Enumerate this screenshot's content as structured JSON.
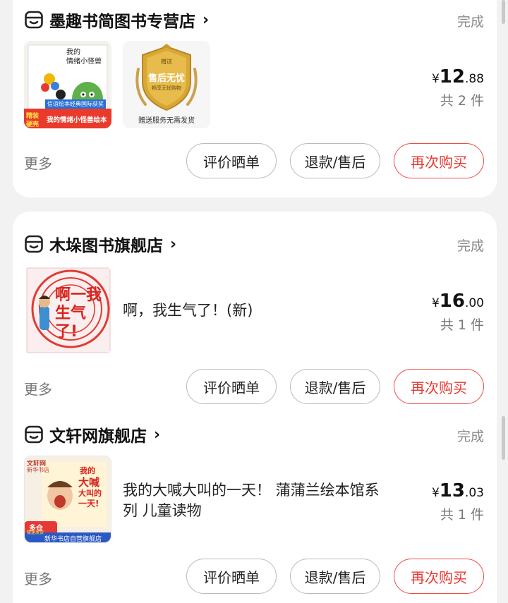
{
  "orders": [
    {
      "shop": "墨趣书简图书专营店",
      "status": "完成",
      "thumb1": {
        "line1": "我的",
        "line2": "情绪小怪兽",
        "banner": "信谊绘本经典国际获奖",
        "tag1": "精装",
        "tag2": "硬壳",
        "strip": "我的情绪小怪兽绘本"
      },
      "thumb2": {
        "top": "赠送",
        "main": "售后无忧",
        "sub": "畅享无忧购物",
        "caption": "赠送服务无需发货"
      },
      "price": {
        "symbol": "¥",
        "int": "12",
        "dec": ".88"
      },
      "qty": "共 2 件",
      "actions": {
        "more": "更多",
        "review": "评价晒单",
        "refund": "退款/售后",
        "rebuy": "再次购买"
      }
    },
    {
      "shop": "木垛图书旗舰店",
      "status": "完成",
      "thumb": {
        "text": "啊一我生气了!"
      },
      "title": "啊，我生气了！(新)",
      "price": {
        "symbol": "¥",
        "int": "16",
        "dec": ".00"
      },
      "qty": "共 1 件",
      "actions": {
        "more": "更多",
        "review": "评价晒单",
        "refund": "退款/售后",
        "rebuy": "再次购买"
      }
    },
    {
      "shop": "文轩网旗舰店",
      "status": "完成",
      "thumb": {
        "logo": "文轩网",
        "sub": "新华书店",
        "title1": "我的",
        "title2": "大喊",
        "title3": "大叫的",
        "title4": "一天!",
        "badge1": "多仓",
        "badge2": "极速发货",
        "strip": "新华书店自营旗舰店"
      },
      "title_line1": "我的大喊大叫的一天！ 蒲蒲兰绘本馆系",
      "title_line2": "列 儿童读物",
      "price": {
        "symbol": "¥",
        "int": "13",
        "dec": ".03"
      },
      "qty": "共 1 件",
      "actions": {
        "more": "更多",
        "review": "评价晒单",
        "refund": "退款/售后",
        "rebuy": "再次购买"
      }
    }
  ]
}
